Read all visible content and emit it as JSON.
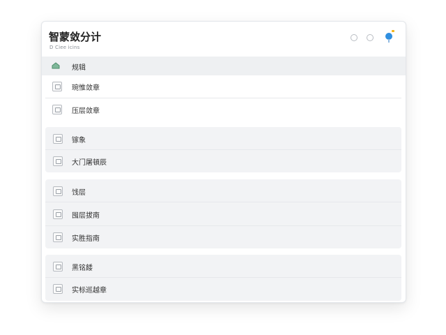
{
  "app": {
    "title": "智蒙敛分计",
    "subtitle": "D Ciee icins"
  },
  "nav": {
    "active_item": {
      "label": "规辑",
      "icon": "home-icon"
    }
  },
  "sections": [
    {
      "items": [
        {
          "label": "琬惟敛章",
          "icon": "image-icon"
        },
        {
          "label": "压层敛章",
          "icon": "picture-icon"
        }
      ]
    },
    {
      "items": [
        {
          "label": "镓象",
          "icon": "photo-icon"
        },
        {
          "label": "大门屠頓辰",
          "icon": "document-icon"
        }
      ]
    },
    {
      "items": [
        {
          "label": "饯层",
          "icon": "layers-icon"
        },
        {
          "label": "囤层拔南",
          "icon": "grid-icon"
        },
        {
          "label": "实胜指南",
          "icon": "guide-icon"
        }
      ]
    },
    {
      "items": [
        {
          "label": "黑铭餧",
          "icon": "edit-icon"
        },
        {
          "label": "实标巡越章",
          "icon": "target-icon"
        }
      ]
    }
  ],
  "colors": {
    "accent": "#2f8fe0",
    "badge": "#f2b51b",
    "active_row": "#eef0f2",
    "group_bg": "#f2f3f5"
  }
}
